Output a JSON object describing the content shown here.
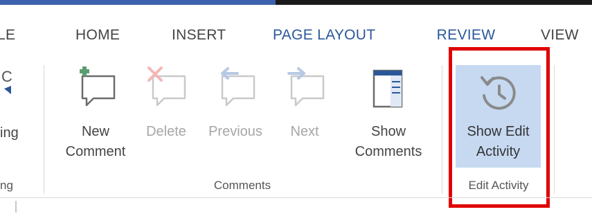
{
  "colors": {
    "accent": "#2b579a",
    "highlight": "#c6d9f1",
    "annotation_red": "#e00000",
    "comment_green": "#5a9e6f",
    "delete_red": "#f3b6b6"
  },
  "tabs": [
    {
      "label": "LE",
      "state": "partial"
    },
    {
      "label": "HOME",
      "state": "normal"
    },
    {
      "label": "INSERT",
      "state": "normal"
    },
    {
      "label": "PAGE LAYOUT",
      "state": "normal"
    },
    {
      "label": "REVIEW",
      "state": "selected"
    },
    {
      "label": "VIEW",
      "state": "normal"
    }
  ],
  "ribbon": {
    "left_partial": {
      "top_glyph": "C",
      "label": "ing",
      "group_label": "ng"
    },
    "comments_group": {
      "buttons": [
        {
          "label": "New\nComment",
          "icon": "new-comment-icon",
          "enabled": true
        },
        {
          "label": "Delete",
          "icon": "delete-comment-icon",
          "enabled": false
        },
        {
          "label": "Previous",
          "icon": "previous-comment-icon",
          "enabled": false
        },
        {
          "label": "Next",
          "icon": "next-comment-icon",
          "enabled": false
        },
        {
          "label": "Show\nComments",
          "icon": "show-comments-icon",
          "enabled": true
        }
      ],
      "group_label": "Comments"
    },
    "edit_activity_group": {
      "button": {
        "label": "Show Edit\nActivity",
        "icon": "history-icon",
        "enabled": true,
        "highlighted": true
      },
      "group_label": "Edit Activity"
    }
  }
}
